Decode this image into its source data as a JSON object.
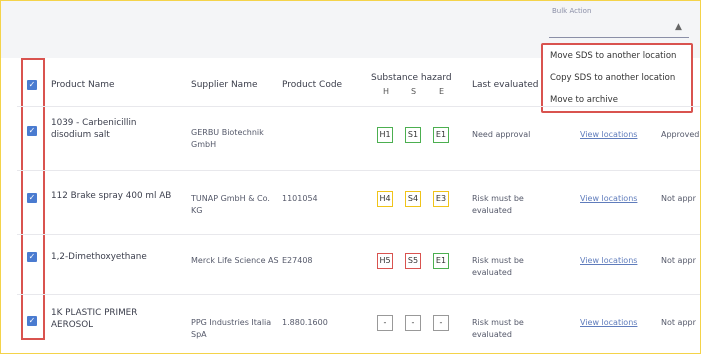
{
  "bulk_action": {
    "label": "Bulk Action",
    "caret": "▲"
  },
  "menu": {
    "items": [
      "Move SDS to another location",
      "Copy SDS to another location",
      "Move to archive"
    ]
  },
  "header": {
    "product_name": "Product Name",
    "supplier_name": "Supplier Name",
    "product_code": "Product Code",
    "substance_hazard": "Substance hazard",
    "hazard_sub": [
      "H",
      "S",
      "E"
    ],
    "last_evaluated": "Last evaluated"
  },
  "rows": [
    {
      "product": "1039 - Carbenicillin disodium salt",
      "supplier": "GERBU Biotechnik GmbH",
      "code": "",
      "hazards": [
        "H1",
        "S1",
        "E1"
      ],
      "hazard_colors": [
        "#4caf50",
        "#4caf50",
        "#4caf50"
      ],
      "evaluation": "Need approval",
      "link": "View locations",
      "status": "Approved"
    },
    {
      "product": "112 Brake spray 400 ml AB",
      "supplier": "TUNAP GmbH & Co. KG",
      "code": "1101054",
      "hazards": [
        "H4",
        "S4",
        "E3"
      ],
      "hazard_colors": [
        "#f0c419",
        "#f0c419",
        "#f0c419"
      ],
      "evaluation": "Risk must be evaluated",
      "link": "View locations",
      "status": "Not appr"
    },
    {
      "product": "1,2-Dimethoxyethane",
      "supplier": "Merck Life Science AS",
      "code": "E27408",
      "hazards": [
        "H5",
        "S5",
        "E1"
      ],
      "hazard_colors": [
        "#d9534f",
        "#d9534f",
        "#4caf50"
      ],
      "evaluation": "Risk must be evaluated",
      "link": "View locations",
      "status": "Not appr"
    },
    {
      "product": "1K PLASTIC PRIMER AEROSOL",
      "supplier": "PPG Industries Italia SpA",
      "code": "1.880.1600",
      "hazards": [
        "-",
        "-",
        "-"
      ],
      "hazard_colors": [
        "#999999",
        "#999999",
        "#999999"
      ],
      "evaluation": "Risk must be evaluated",
      "link": "View locations",
      "status": "Not appr"
    }
  ],
  "colors": {
    "accent": "#4a7bd0",
    "highlight_border": "#d9534f",
    "link": "#5f7cbc",
    "frame_border": "#f4d34a"
  }
}
